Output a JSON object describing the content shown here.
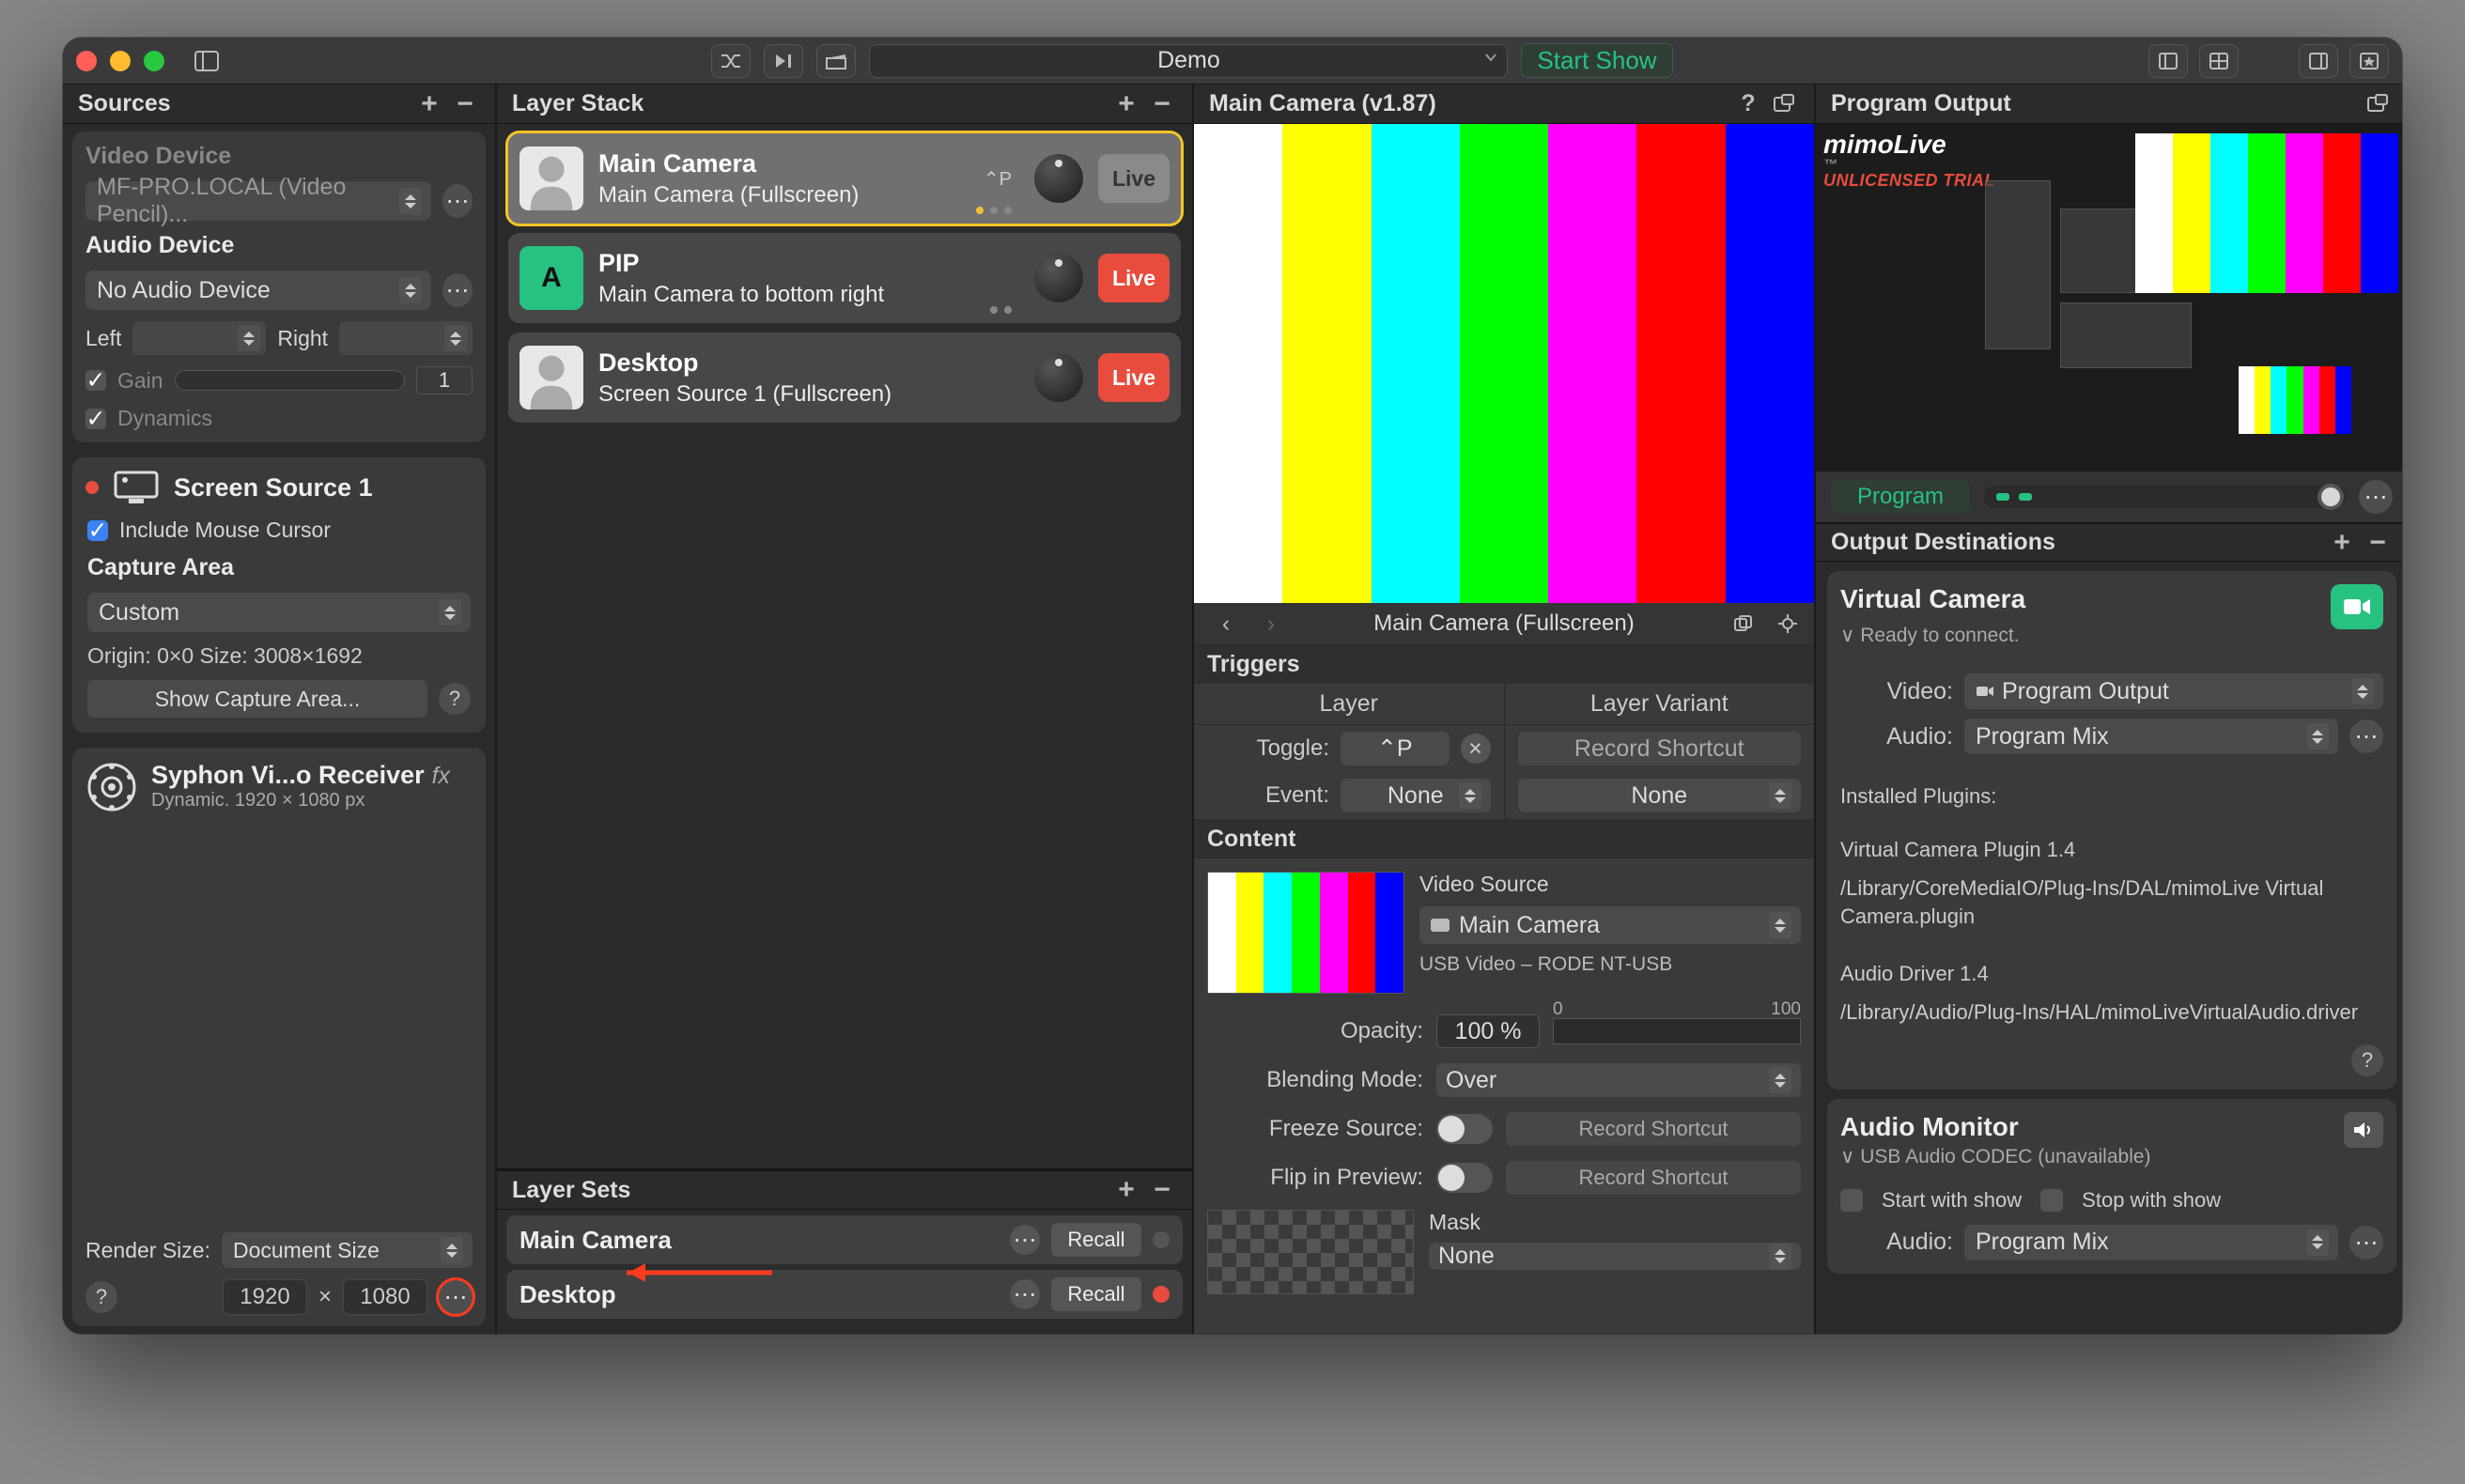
{
  "titlebar": {
    "document": "Demo",
    "start": "Start Show"
  },
  "sources": {
    "title": "Sources",
    "videoDevice": "Video Device",
    "videoSel": "MF-PRO.LOCAL (Video Pencil)...",
    "audioDevice": "Audio Device",
    "audioSel": "No Audio Device",
    "left": "Left",
    "right": "Right",
    "gain": "Gain",
    "gainVal": "1",
    "dynamics": "Dynamics",
    "screenSource": {
      "title": "Screen Source 1",
      "includeCursor": "Include Mouse Cursor",
      "captureArea": "Capture Area",
      "captureSel": "Custom",
      "originSize": "Origin: 0×0 Size: 3008×1692",
      "showBtn": "Show Capture Area..."
    },
    "syphon": {
      "title": "Syphon Vi...o Receiver",
      "sub": "Dynamic. 1920 × 1080 px",
      "renderSize": "Render Size:",
      "rsSel": "Document Size",
      "w": "1920",
      "h": "1080"
    }
  },
  "layers": {
    "title": "Layer Stack",
    "items": [
      {
        "title": "Main Camera",
        "sub": "Main Camera (Fullscreen)",
        "shortcut": "⌃P",
        "live": "Live",
        "thumb": "person",
        "liveState": "on"
      },
      {
        "title": "PIP",
        "sub": "Main Camera to bottom right",
        "shortcut": "",
        "live": "Live",
        "thumb": "A",
        "liveState": "red"
      },
      {
        "title": "Desktop",
        "sub": "Screen Source 1 (Fullscreen)",
        "shortcut": "",
        "live": "Live",
        "thumb": "person",
        "liveState": "red"
      }
    ],
    "setsTitle": "Layer Sets",
    "sets": [
      {
        "name": "Main Camera",
        "recall": "Recall",
        "live": false
      },
      {
        "name": "Desktop",
        "recall": "Recall",
        "live": true
      }
    ]
  },
  "preview": {
    "title": "Main Camera (v1.87)",
    "inspectorTitle": "Main Camera (Fullscreen)",
    "triggers": "Triggers",
    "layerTab": "Layer",
    "variantTab": "Layer Variant",
    "toggle": "Toggle:",
    "toggleVal": "⌃P",
    "event": "Event:",
    "eventVal": "None",
    "recordShortcut": "Record Shortcut",
    "variantNone": "None",
    "content": "Content",
    "videoSource": "Video Source",
    "videoSel": "Main Camera",
    "usb": "USB Video – RODE NT-USB",
    "opacity": "Opacity:",
    "opacityVal": "100 %",
    "scale0": "0",
    "scale100": "100",
    "blending": "Blending Mode:",
    "blendingVal": "Over",
    "freeze": "Freeze Source:",
    "flip": "Flip in Preview:",
    "mask": "Mask",
    "maskVal": "None"
  },
  "output": {
    "title": "Program Output",
    "logo": "mimoLive",
    "tm": "™",
    "unlic": "UNLICENSED TRIAL",
    "program": "Program",
    "destTitle": "Output Destinations",
    "vc": {
      "title": "Virtual Camera",
      "sub": "Ready to connect.",
      "video": "Video:",
      "videoSel": "Program Output",
      "audio": "Audio:",
      "audioSel": "Program Mix",
      "plugins": "Installed Plugins:",
      "p1": "Virtual Camera Plugin 1.4",
      "p1path": "/Library/CoreMediaIO/Plug-Ins/DAL/mimoLive Virtual Camera.plugin",
      "p2": "Audio Driver 1.4",
      "p2path": "/Library/Audio/Plug-Ins/HAL/mimoLiveVirtualAudio.driver"
    },
    "am": {
      "title": "Audio Monitor",
      "sub": "USB Audio CODEC  (unavailable)",
      "start": "Start with show",
      "stop": "Stop with show",
      "audio": "Audio:",
      "audioSel": "Program Mix"
    }
  }
}
